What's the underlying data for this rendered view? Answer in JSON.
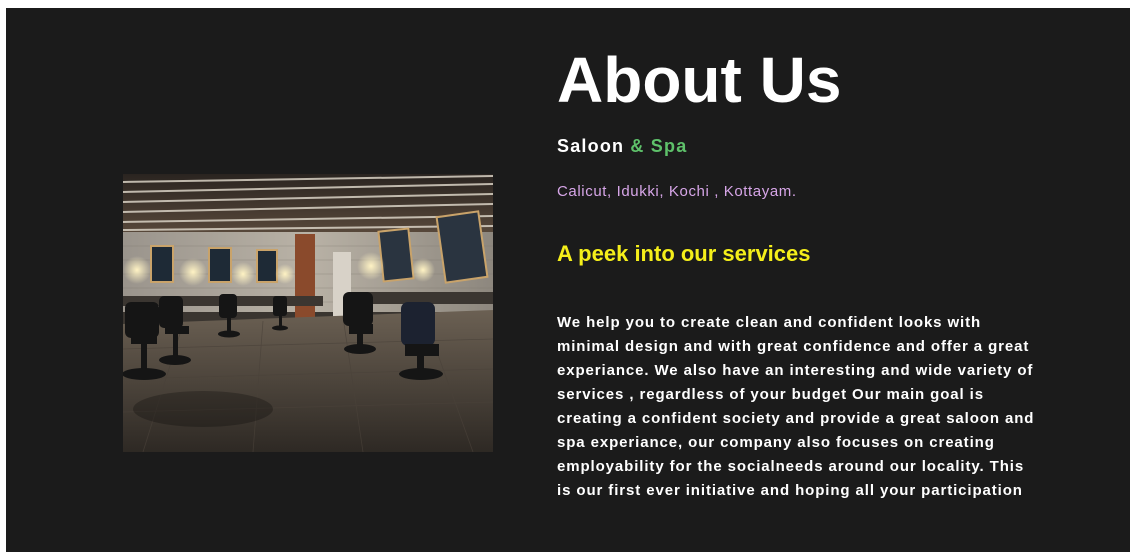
{
  "about": {
    "title": "About Us",
    "subtitle_main": "Saloon",
    "subtitle_accent": "& Spa",
    "locations": "Calicut, Idukki, Kochi , Kottayam.",
    "services_heading": "A peek into our services",
    "description": "We help you to create clean and confident looks with minimal design and with great confidence and offer a great experiance. We also have an interesting and wide variety of services , regardless of your budget Our main goal is creating a confident society and provide a great saloon and spa experiance, our company also focuses on creating employability for the socialneeds around our locality. This is our first ever initiative and hoping all your participation"
  },
  "colors": {
    "background": "#1b1b1b",
    "accent_green": "#5ec16a",
    "locations_purple": "#d7a6e8",
    "heading_yellow": "#f5ef1a"
  }
}
